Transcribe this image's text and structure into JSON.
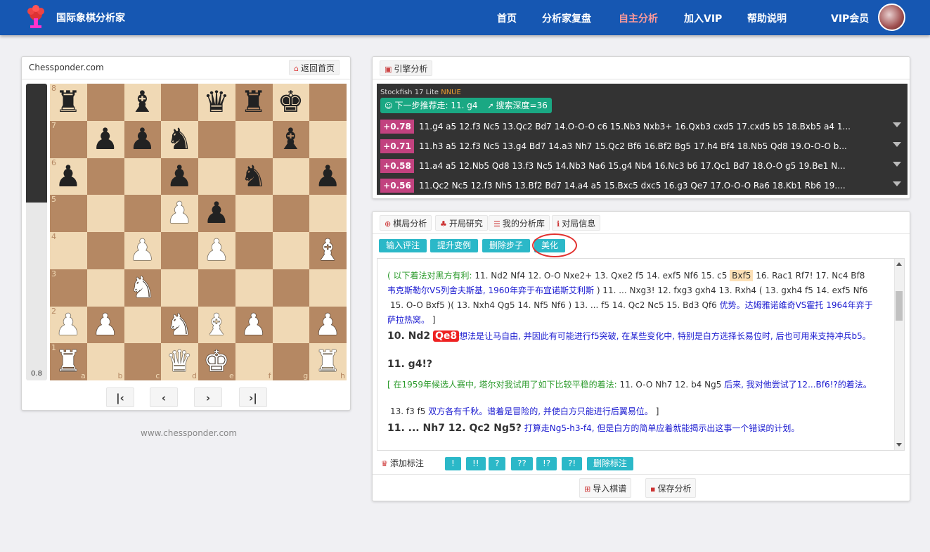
{
  "nav": {
    "brand": "国际象棋分析家",
    "items": [
      "首页",
      "分析家复盘",
      "自主分析",
      "加入VIP",
      "帮助说明",
      "VIP会员"
    ],
    "active": "自主分析",
    "accent": "#1657b2"
  },
  "board_panel": {
    "site": "Chessponder.com",
    "back_label": "返回首页",
    "eval": "0.8",
    "eval_fraction_black": 0.4,
    "nav_buttons": [
      "first",
      "prev",
      "next",
      "last"
    ],
    "ranks": [
      "8",
      "7",
      "6",
      "5",
      "4",
      "3",
      "2",
      "1"
    ],
    "files": [
      "a",
      "b",
      "c",
      "d",
      "e",
      "f",
      "g",
      "h"
    ],
    "position": [
      [
        "r",
        "",
        "b",
        "",
        "q",
        "r",
        "k",
        ""
      ],
      [
        "",
        "p",
        "p",
        "n",
        "",
        "",
        "b",
        ""
      ],
      [
        "p",
        "",
        "",
        "p",
        "",
        "n",
        "",
        "p"
      ],
      [
        "",
        "",
        "",
        "P",
        "p",
        "",
        "",
        ""
      ],
      [
        "",
        "",
        "P",
        "",
        "P",
        "",
        "",
        "B"
      ],
      [
        "",
        "",
        "N",
        "",
        "",
        "",
        "",
        ""
      ],
      [
        "P",
        "P",
        "",
        "N",
        "B",
        "P",
        "",
        "P"
      ],
      [
        "R",
        "",
        "",
        "Q",
        "K",
        "",
        "",
        "R"
      ]
    ]
  },
  "footer": "www.chessponder.com",
  "engine": {
    "tab": "引擎分析",
    "version": "Stockfish 17 Lite",
    "nnue": "NNUE",
    "recommend": "下一步推荐走: 11. g4",
    "depth": "搜索深度=36",
    "lines": [
      {
        "score": "+0.78",
        "moves": "11.g4 a5 12.f3 Nc5 13.Qc2 Bd7 14.O-O-O c6 15.Nb3 Nxb3+ 16.Qxb3 cxd5 17.cxd5 b5 18.Bxb5 a4 1..."
      },
      {
        "score": "+0.71",
        "moves": "11.h3 a5 12.f3 Nc5 13.g4 Bd7 14.a3 Nh7 15.Qc2 Bf6 16.Bf2 Bg5 17.h4 Bf4 18.Nb5 Qd8 19.O-O-O b..."
      },
      {
        "score": "+0.58",
        "moves": "11.a4 a5 12.Nb5 Qd8 13.f3 Nc5 14.Nb3 Na6 15.g4 Nb4 16.Nc3 b6 17.Qc1 Bd7 18.O-O g5 19.Be1 N..."
      },
      {
        "score": "+0.56",
        "moves": "11.Qc2 Nc5 12.f3 Nh5 13.Bf2 Bd7 14.a4 a5 15.Bxc5 dxc5 16.g3 Qe7 17.O-O-O Ra6 18.Kb1 Rb6 19...."
      }
    ]
  },
  "analysis": {
    "tabs": [
      "棋局分析",
      "开局研究",
      "我的分析库",
      "对局信息"
    ],
    "tools": [
      "输入评注",
      "提升变例",
      "删除步子",
      "美化"
    ],
    "notes": {
      "l1_g": "( 以下着法对黑方有利: ",
      "l1_k": "11. Nd2  Nf4  12. O-O  Nxe2+  13. Qxe2  f5  14. exf5  Nf6  15. c5 ",
      "l1_hl": "Bxf5",
      "l1_k2": " 16. Rac1  Rf7!  17. Nc4  Bf8",
      "l2_b": "韦克斯勒尔VS列舍夫斯基, 1960年弈于布宜诺斯艾利斯",
      "l2_k": " ) 11. ... Nxg3!  12. fxg3  gxh4  13. Rxh4  (  13. gxh4  f5  14. exf5  Nf6",
      "l3_k": "15. O-O  Bxf5  )(  13. Nxh4  Qg5  14. Nf5  Nf6  ) 13. ... f5  14. Qc2  Nc5  15. Bd3  Qf6 ",
      "l3_b": "优势。达姆雅诺维奇VS霍托 1964年弈于",
      "l4_b": "萨拉热窝。",
      "l4_k": " ]",
      "l5_mv": "10. Nd2",
      "l5_q": "Qe8",
      "l5_b": "想法是让马自由, 并因此有可能进行f5突破, 在某些变化中, 特别是白方选择长易位时, 后也可用来支持冲兵b5。",
      "l6": "11. g4!?",
      "l7_g": "[  在1959年候选人赛中, 塔尔对我试用了如下比较平稳的着法: ",
      "l7_k": " 11. O-O  Nh7  12. b4  Ng5 ",
      "l7_b": " 后来, 我对他尝试了12...Bf6!?的着法。",
      "l8_k": "13. f3  f5 ",
      "l8_b": " 双方各有千秋。谱着是冒险的, 并使白方只能进行后翼易位。",
      "l8_k2": " ]",
      "l9_mv": "11. ... Nh7   12. Qc2   Ng5?",
      "l9_b": " 打算走Ng5-h3-f4, 但是白方的简单应着就能揭示出这事一个错误的计划。"
    },
    "annot_label": "添加标注",
    "annot_buttons": [
      "!",
      "!!",
      "?",
      "??",
      "!?",
      "?!",
      "删除标注"
    ],
    "import_label": "导入棋谱",
    "save_label": "保存分析"
  }
}
